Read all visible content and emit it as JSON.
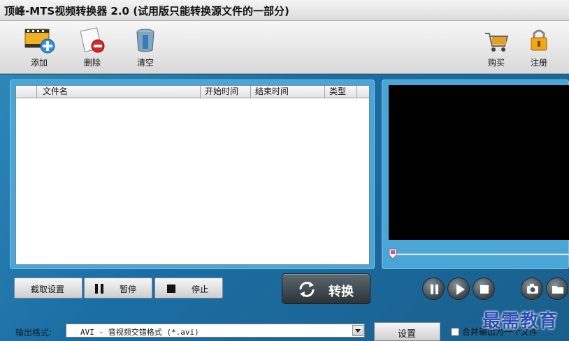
{
  "window": {
    "title": "顶峰-MTS视频转换器 2.0 (试用版只能转换源文件的一部分)"
  },
  "toolbar": {
    "add_label": "添加",
    "delete_label": "删除",
    "clear_label": "清空",
    "buy_label": "购买",
    "register_label": "注册"
  },
  "filelist": {
    "columns": [
      "",
      "文件名",
      "开始时间",
      "结束时间",
      "类型"
    ],
    "rows": []
  },
  "controls": {
    "trim_label": "截取设置",
    "pause_label": "暂停",
    "stop_label": "停止",
    "convert_label": "转换"
  },
  "player": {
    "icons": [
      "pause-icon",
      "play-icon",
      "stop-icon",
      "snapshot-icon",
      "open-folder-icon"
    ]
  },
  "output": {
    "format_label": "输出格式:",
    "format_value": "AVI - 音视频交错格式 (*.avi)",
    "settings_label": "设置",
    "merge_label": "合并输出为一个文件",
    "merge_checked": false
  },
  "watermark": "最需教育",
  "colors": {
    "panel": "#4aa6d6",
    "background": "#1a5f8c",
    "video": "#000000",
    "convert": "#2b3338"
  }
}
